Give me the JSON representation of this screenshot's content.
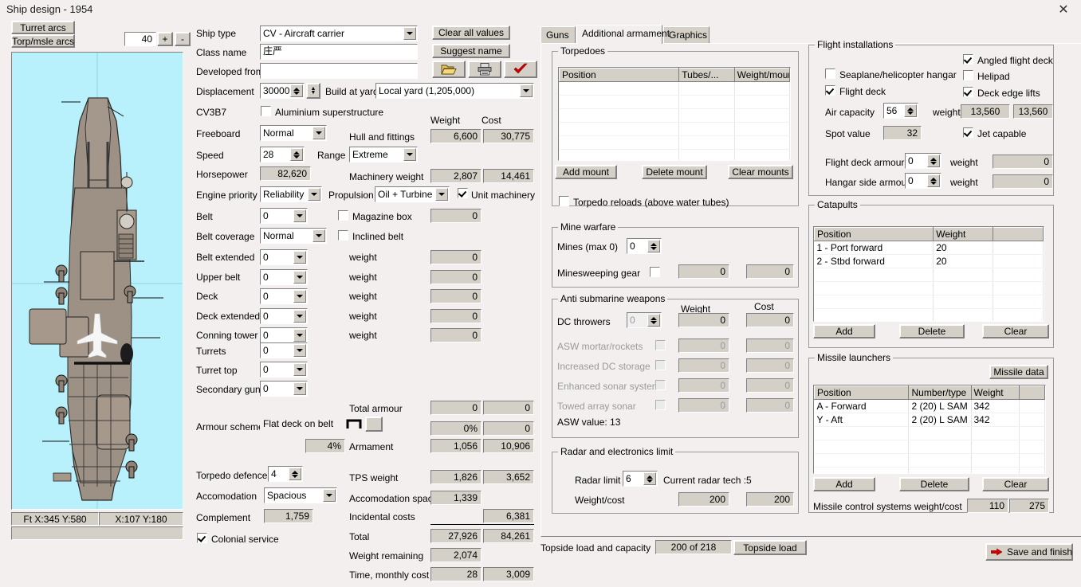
{
  "window": {
    "title": "Ship design - 1954",
    "close_icon": "close-icon"
  },
  "ship_view": {
    "turret_arcs_button": "Turret arcs",
    "torp_arcs_button": "Torp/msle arcs",
    "zoom_value": "40",
    "zoom_plus": "+",
    "zoom_minus": "-",
    "status_left": "Ft X:345 Y:580",
    "status_right": "X:107 Y:180",
    "status_bottom": ""
  },
  "design": {
    "ship_type_label": "Ship type",
    "ship_type_value": "CV - Aircraft carrier",
    "class_name_label": "Class name",
    "class_name_value": "庄严",
    "developed_from_label": "Developed from",
    "developed_from_value": "",
    "displacement_label": "Displacement",
    "displacement_value": "30000",
    "build_at_yard_label": "Build at yard",
    "build_at_yard_value": "Local yard (1,205,000)",
    "designation_label": "CV3B7",
    "aluminium_label": "Aluminium superstructure",
    "aluminium_checked": false,
    "freeboard_label": "Freeboard",
    "freeboard_value": "Normal",
    "speed_label": "Speed",
    "speed_value": "28",
    "range_label": "Range",
    "range_value": "Extreme",
    "horsepower_label": "Horsepower",
    "horsepower_value": "82,620",
    "engine_priority_label": "Engine priority",
    "engine_priority_value": "Reliability",
    "propulsion_label": "Propulsion",
    "propulsion_value": "Oil + Turbine",
    "unit_machinery_label": "Unit machinery",
    "unit_machinery_checked": true,
    "belt_label": "Belt",
    "belt_value": "0",
    "magazine_box_label": "Magazine box",
    "magazine_box_checked": false,
    "magazine_box_weight": "0",
    "belt_coverage_label": "Belt coverage",
    "belt_coverage_value": "Normal",
    "inclined_belt_label": "Inclined belt",
    "inclined_belt_checked": false,
    "armour_rows": [
      {
        "label": "Belt extended",
        "value": "0",
        "wlabel": "weight",
        "weight": "0"
      },
      {
        "label": "Upper belt",
        "value": "0",
        "wlabel": "weight",
        "weight": "0"
      },
      {
        "label": "Deck",
        "value": "0",
        "wlabel": "weight",
        "weight": "0"
      },
      {
        "label": "Deck extended",
        "value": "0",
        "wlabel": "weight",
        "weight": "0"
      },
      {
        "label": "Conning tower",
        "value": "0",
        "wlabel": "weight",
        "weight": "0"
      }
    ],
    "turrets_label": "Turrets",
    "turrets_value": "0",
    "turret_top_label": "Turret top",
    "turret_top_value": "0",
    "secondary_guns_label": "Secondary guns",
    "secondary_guns_value": "0",
    "armour_scheme_label": "Armour scheme",
    "armour_scheme_value": "Flat deck on belt",
    "armour_pct": "4%",
    "torpedo_defence_label": "Torpedo defence",
    "torpedo_defence_value": "4",
    "accomodation_label": "Accomodation",
    "accomodation_value": "Spacious",
    "complement_label": "Complement",
    "complement_value": "1,759",
    "colonial_service_label": "Colonial service",
    "colonial_service_checked": true
  },
  "toolbar": {
    "clear_all_values": "Clear all values",
    "suggest_name": "Suggest name",
    "open_icon": "folder-open-icon",
    "print_icon": "printer-icon",
    "confirm_icon": "red-check-icon"
  },
  "weights": {
    "weight_header": "Weight",
    "cost_header": "Cost",
    "rows": [
      {
        "label": "Hull and fittings",
        "weight": "6,600",
        "cost": "30,775"
      },
      {
        "label": "Machinery weight",
        "weight": "2,807",
        "cost": "14,461"
      },
      {
        "label": "Total armour",
        "weight": "0",
        "cost": "0"
      },
      {
        "label": "",
        "weight": "0%",
        "cost": "0"
      },
      {
        "label": "Armament",
        "weight": "1,056",
        "cost": "10,906"
      },
      {
        "label": "TPS weight",
        "weight": "1,826",
        "cost": "3,652"
      },
      {
        "label": "Accomodation space",
        "weight": "1,339",
        "cost": ""
      },
      {
        "label": "Incidental costs",
        "weight": "",
        "cost": "6,381"
      },
      {
        "label": "Total",
        "weight": "27,926",
        "cost": "84,261"
      },
      {
        "label": "Weight remaining",
        "weight": "2,074",
        "cost": ""
      },
      {
        "label": "Time, monthly cost",
        "weight": "28",
        "cost": "3,009"
      }
    ]
  },
  "tabs": {
    "items": [
      {
        "label": "Guns",
        "active": false
      },
      {
        "label": "Additional armament",
        "active": true
      },
      {
        "label": "Graphics",
        "active": false
      }
    ]
  },
  "torpedoes": {
    "caption": "Torpedoes",
    "columns": [
      "Position",
      "Tubes/...",
      "Weight/mount"
    ],
    "rows": [],
    "empty_row_count": 7,
    "add_mount": "Add mount",
    "delete_mount": "Delete mount",
    "clear_mounts": "Clear mounts",
    "reloads_label": "Torpedo reloads (above water tubes)",
    "reloads_checked": false
  },
  "mine_warfare": {
    "caption": "Mine warfare",
    "mines_label": "Mines (max 0)",
    "mines_value": "0",
    "minesweeping_label": "Minesweeping gear",
    "minesweeping_checked": false,
    "minesweeping_weight": "0",
    "minesweeping_cost": "0"
  },
  "asw": {
    "caption": "Anti submarine weapons",
    "weight_header": "Weight",
    "cost_header": "Cost",
    "dc_throwers_label": "DC throwers",
    "dc_throwers_value": "0",
    "dc_throwers_weight": "0",
    "dc_throwers_cost": "0",
    "rows": [
      {
        "label": "ASW mortar/rockets",
        "checked": false,
        "weight": "0",
        "cost": "0",
        "disabled": true
      },
      {
        "label": "Increased DC storage",
        "checked": false,
        "weight": "0",
        "cost": "0",
        "disabled": true
      },
      {
        "label": "Enhanced sonar system",
        "checked": false,
        "weight": "0",
        "cost": "0",
        "disabled": true
      },
      {
        "label": "Towed array sonar",
        "checked": false,
        "weight": "0",
        "cost": "0",
        "disabled": true
      }
    ],
    "asw_value_text": "ASW value: 13"
  },
  "radar": {
    "caption": "Radar and electronics limit",
    "radar_limit_label": "Radar limit",
    "radar_limit_value": "6",
    "current_tech": "Current radar tech :5",
    "weight_cost_label": "Weight/cost",
    "weight": "200",
    "cost": "200"
  },
  "topside": {
    "label": "Topside load and capacity",
    "value": "200 of 218",
    "button": "Topside load"
  },
  "flight": {
    "caption": "Flight installations",
    "seaplane_label": "Seaplane/helicopter hangar",
    "seaplane_checked": false,
    "flight_deck_label": "Flight deck",
    "flight_deck_checked": true,
    "angled_deck_label": "Angled flight deck",
    "angled_deck_checked": true,
    "helipad_label": "Helipad",
    "helipad_checked": false,
    "deck_edge_lifts_label": "Deck edge lifts",
    "deck_edge_lifts_checked": true,
    "air_capacity_label": "Air capacity",
    "air_capacity_value": "56",
    "air_weight_label": "weight",
    "air_weight": "13,560",
    "air_cost": "13,560",
    "spot_value_label": "Spot value",
    "spot_value": "32",
    "jet_capable_label": "Jet capable",
    "jet_capable_checked": true,
    "flight_deck_armour_label": "Flight deck armour",
    "flight_deck_armour_value": "0",
    "flight_deck_armour_wlabel": "weight",
    "flight_deck_armour_weight": "0",
    "hangar_side_armour_label": "Hangar side armour",
    "hangar_side_armour_value": "0",
    "hangar_side_armour_wlabel": "weight",
    "hangar_side_armour_weight": "0"
  },
  "catapults": {
    "caption": "Catapults",
    "columns": [
      "Position",
      "Weight",
      ""
    ],
    "rows": [
      {
        "position": "1 - Port forward",
        "weight": "20",
        "extra": ""
      },
      {
        "position": "2 - Stbd forward",
        "weight": "20",
        "extra": ""
      }
    ],
    "empty_row_count": 5,
    "add": "Add",
    "delete": "Delete",
    "clear": "Clear"
  },
  "missiles": {
    "caption": "Missile launchers",
    "missile_data_button": "Missile data",
    "columns": [
      "Position",
      "Number/type",
      "Weight",
      ""
    ],
    "rows": [
      {
        "position": "A - Forward",
        "type": "2 (20) L SAM",
        "weight": "342",
        "extra": ""
      },
      {
        "position": "Y - Aft",
        "type": "2 (20) L SAM",
        "weight": "342",
        "extra": ""
      }
    ],
    "empty_row_count": 5,
    "add": "Add",
    "delete": "Delete",
    "clear": "Clear",
    "control_label": "Missile control systems weight/cost",
    "control_weight": "110",
    "control_cost": "275"
  },
  "footer": {
    "save_button": "Save and finish",
    "save_icon": "red-arrow-icon"
  },
  "colors": {
    "window_bg": "#f2efee",
    "control_face": "#d4d0c8",
    "sea": "#b8f0fb",
    "hull": "#9c9184",
    "accent_red": "#cc0000"
  }
}
